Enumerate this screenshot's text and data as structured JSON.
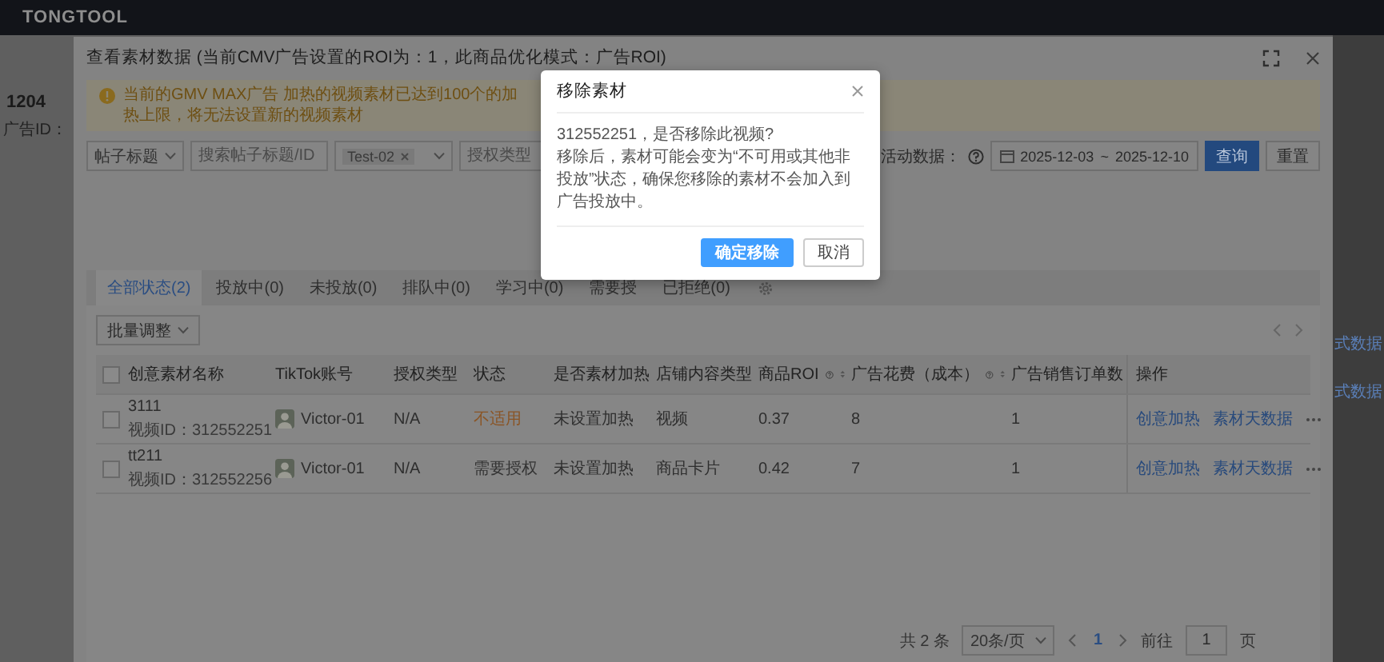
{
  "app_bar": {
    "logo": "TONGTOOL"
  },
  "background": {
    "heading": "1204",
    "id_label": "广告ID：",
    "side_links": [
      "式数据",
      "式数据"
    ]
  },
  "modal": {
    "title": "查看素材数据 (当前CMV广告设置的ROI为：1，此商品优化模式：广告ROI)",
    "warning": "当前的GMV MAX广告 加热的视频素材已达到100个的加热上限，将无法设置新的视频素材",
    "filters": {
      "title_field": "帖子标题",
      "search_placeholder": "搜索帖子标题/ID",
      "account_tag": "Test-02",
      "auth_placeholder": "授权类型",
      "date_label": "活动数据：",
      "date_from": "2025-12-03",
      "date_separator": "~",
      "date_to": "2025-12-10",
      "query_button": "查询",
      "reset_button": "重置"
    },
    "tabs": [
      {
        "label": "全部状态(2)",
        "selected": true
      },
      {
        "label": "投放中(0)",
        "selected": false
      },
      {
        "label": "未投放(0)",
        "selected": false
      },
      {
        "label": "排队中(0)",
        "selected": false
      },
      {
        "label": "学习中(0)",
        "selected": false
      },
      {
        "label": "需要授",
        "selected": false
      },
      {
        "label": "已拒绝(0)",
        "selected": false
      }
    ],
    "batch_button": "批量调整",
    "table": {
      "all_selected": false,
      "columns": [
        {
          "label": "创意素材名称",
          "kind": "text"
        },
        {
          "label": "TikTok账号",
          "kind": "text"
        },
        {
          "label": "授权类型",
          "kind": "text"
        },
        {
          "label": "状态",
          "kind": "text"
        },
        {
          "label": "是否素材加热",
          "kind": "text"
        },
        {
          "label": "店铺内容类型",
          "kind": "text"
        },
        {
          "label": "商品ROI",
          "kind": "metric"
        },
        {
          "label": "广告花费（成本）",
          "kind": "metric"
        },
        {
          "label": "广告销售订单数",
          "kind": "text"
        },
        {
          "label": "操作",
          "kind": "actions"
        }
      ],
      "rows": [
        {
          "selected": false,
          "name": "3111",
          "video_id": "视频ID：312552251",
          "account": "Victor-01",
          "auth_type": "N/A",
          "status": {
            "text": "不适用",
            "color": "#8a5526"
          },
          "heating": "未设置加热",
          "content_type": "视频",
          "roi": "0.37",
          "spend": "8",
          "orders": "1",
          "actions": [
            "创意加热",
            "素材天数据"
          ]
        },
        {
          "selected": false,
          "name": "tt211",
          "video_id": "视频ID：312552256",
          "account": "Victor-01",
          "auth_type": "N/A",
          "status": {
            "text": "需要授权",
            "color": "#333333"
          },
          "heating": "未设置加热",
          "content_type": "商品卡片",
          "roi": "0.42",
          "spend": "7",
          "orders": "1",
          "actions": [
            "创意加热",
            "素材天数据"
          ]
        }
      ]
    },
    "pagination": {
      "total": "共 2 条",
      "page_size": "20条/页",
      "pages": [
        {
          "label": "1",
          "selected": true
        }
      ],
      "goto_label": "前往",
      "goto_value": "1",
      "page_unit": "页"
    }
  },
  "dialog": {
    "title": "移除素材",
    "message": [
      "312552251，是否移除此视频?",
      "移除后，素材可能会变为“不可用或其他非投放”状态，确保您移除的素材不会加入到广告投放中。"
    ],
    "confirm_button": "确定移除",
    "cancel_button": "取消"
  }
}
